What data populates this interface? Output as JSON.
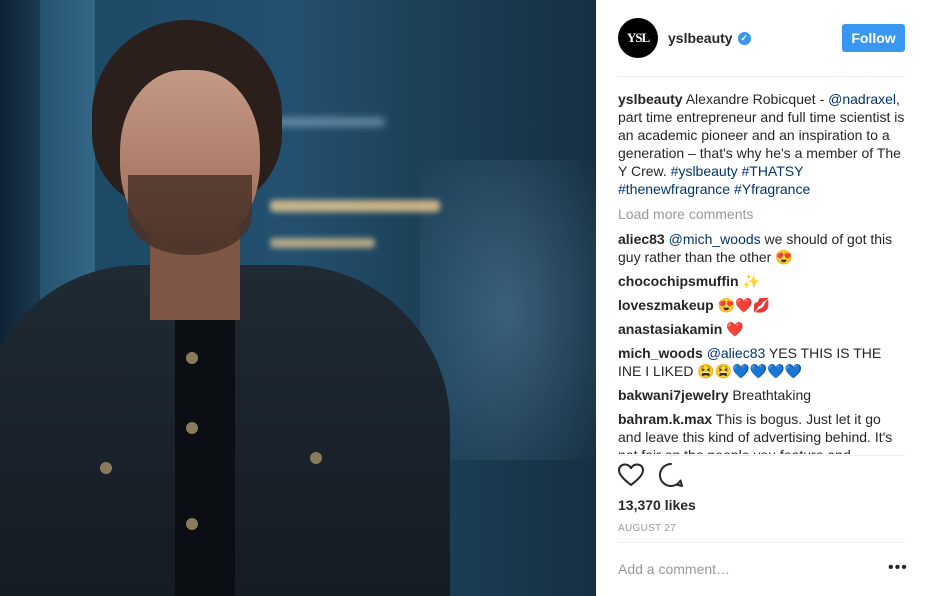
{
  "post": {
    "username": "yslbeauty",
    "avatar_text": "YSL",
    "follow_label": "Follow",
    "caption": {
      "username": "yslbeauty",
      "text_1": " Alexandre Robicquet - ",
      "mention": "@nadraxel",
      "text_2": ", part time entrepreneur and full time scientist is an academic pioneer and an inspiration to a generation – that's why he's a member of The Y Crew. ",
      "tag_1": "#yslbeauty",
      "tag_2": "#THATSY",
      "tag_3": "#thenewfragrance",
      "tag_4": "#Yfragrance"
    },
    "load_more": "Load more comments",
    "comments": [
      {
        "user": "aliec83",
        "mention": "@mich_woods",
        "text": " we should of got this guy rather than the other 😍"
      },
      {
        "user": "chocochipsmuffin",
        "mention": "",
        "text": " ✨"
      },
      {
        "user": "loveszmakeup",
        "mention": "",
        "text": " 😍❤️💋"
      },
      {
        "user": "anastasiakamin",
        "mention": "",
        "text": " ❤️"
      },
      {
        "user": "mich_woods",
        "mention": "@aliec83",
        "text": " YES THIS IS THE INE I LIKED 😫😫💙💙💙💙"
      },
      {
        "user": "bakwani7jewelry",
        "mention": "",
        "text": " Breathtaking"
      },
      {
        "user": "bahram.k.max",
        "mention": "",
        "text": " This is bogus. Just let it go and leave this kind of advertising behind. It's not fair on the people you feature and"
      }
    ],
    "likes": "13,370 likes",
    "date": "AUGUST 27",
    "add_comment_placeholder": "Add a comment…",
    "more_label": "•••",
    "colors": {
      "accent": "#3897f0",
      "link": "#003569",
      "muted": "#999999"
    },
    "icons": [
      "heart-icon",
      "comment-icon",
      "more-options-icon",
      "verified-badge-icon"
    ]
  }
}
